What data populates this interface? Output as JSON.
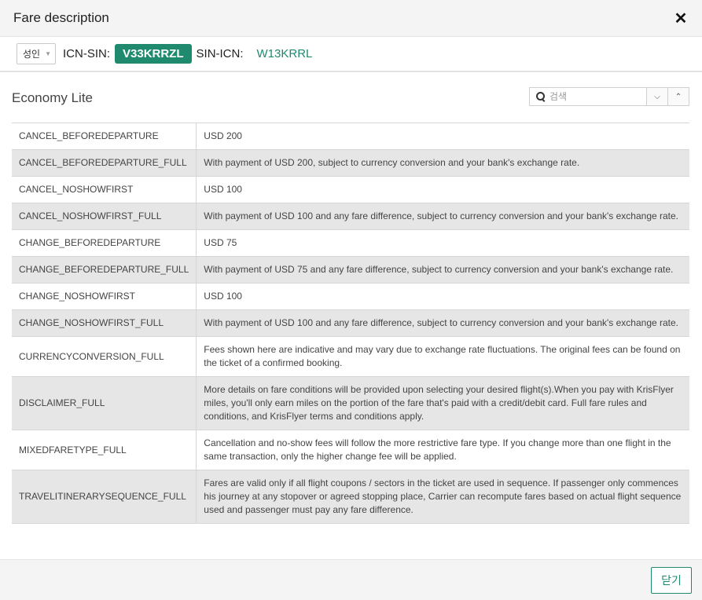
{
  "header": {
    "title": "Fare description",
    "close_glyph": "✕"
  },
  "route_bar": {
    "passenger_type": "성인",
    "segments": [
      {
        "route": "ICN-SIN:",
        "fare_code": "V33KRRZL",
        "active": true
      },
      {
        "route": "SIN-ICN:",
        "fare_code": "W13KRRL",
        "active": false
      }
    ]
  },
  "section": {
    "title": "Economy Lite",
    "search_placeholder": "검색"
  },
  "fare_rules": [
    {
      "key": "CANCEL_BEFOREDEPARTURE",
      "value": "USD 200"
    },
    {
      "key": "CANCEL_BEFOREDEPARTURE_FULL",
      "value": "With payment of USD 200, subject to currency conversion and your bank's exchange rate."
    },
    {
      "key": "CANCEL_NOSHOWFIRST",
      "value": "USD 100"
    },
    {
      "key": "CANCEL_NOSHOWFIRST_FULL",
      "value": "With payment of USD 100 and any fare difference, subject to currency conversion and your bank's exchange rate."
    },
    {
      "key": "CHANGE_BEFOREDEPARTURE",
      "value": "USD 75"
    },
    {
      "key": "CHANGE_BEFOREDEPARTURE_FULL",
      "value": "With payment of USD 75 and any fare difference, subject to currency conversion and your bank's exchange rate."
    },
    {
      "key": "CHANGE_NOSHOWFIRST",
      "value": "USD 100"
    },
    {
      "key": "CHANGE_NOSHOWFIRST_FULL",
      "value": "With payment of USD 100 and any fare difference, subject to currency conversion and your bank's exchange rate."
    },
    {
      "key": "CURRENCYCONVERSION_FULL",
      "value": "Fees shown here are indicative and may vary due to exchange rate fluctuations. The original fees can be found on the ticket of a confirmed booking."
    },
    {
      "key": "DISCLAIMER_FULL",
      "value": "More details on fare conditions will be provided upon selecting your desired flight(s).When you pay with KrisFlyer miles, you'll only earn miles on the portion of the fare that's paid with a credit/debit card. Full fare rules and conditions, and KrisFlyer terms and conditions apply."
    },
    {
      "key": "MIXEDFARETYPE_FULL",
      "value": "Cancellation and no-show fees will follow the more restrictive fare type. If you change more than one flight in the same transaction, only the higher change fee will be applied."
    },
    {
      "key": "TRAVELITINERARYSEQUENCE_FULL",
      "value": "Fares are valid only if all flight coupons / sectors in the ticket are used in sequence. If passenger only commences his journey at any stopover or agreed stopping place, Carrier can recompute fares based on actual flight sequence used and passenger must pay any fare difference."
    }
  ],
  "footer": {
    "close_label": "닫기"
  },
  "colors": {
    "accent": "#1f8a6e",
    "row_alt": "#e6e6e6",
    "header_bg": "#f4f4f4"
  },
  "icons": {
    "close": "close-icon",
    "search": "search-icon",
    "next": "chevron-down-icon",
    "prev": "chevron-up-icon",
    "dropdown": "caret-down-icon"
  }
}
